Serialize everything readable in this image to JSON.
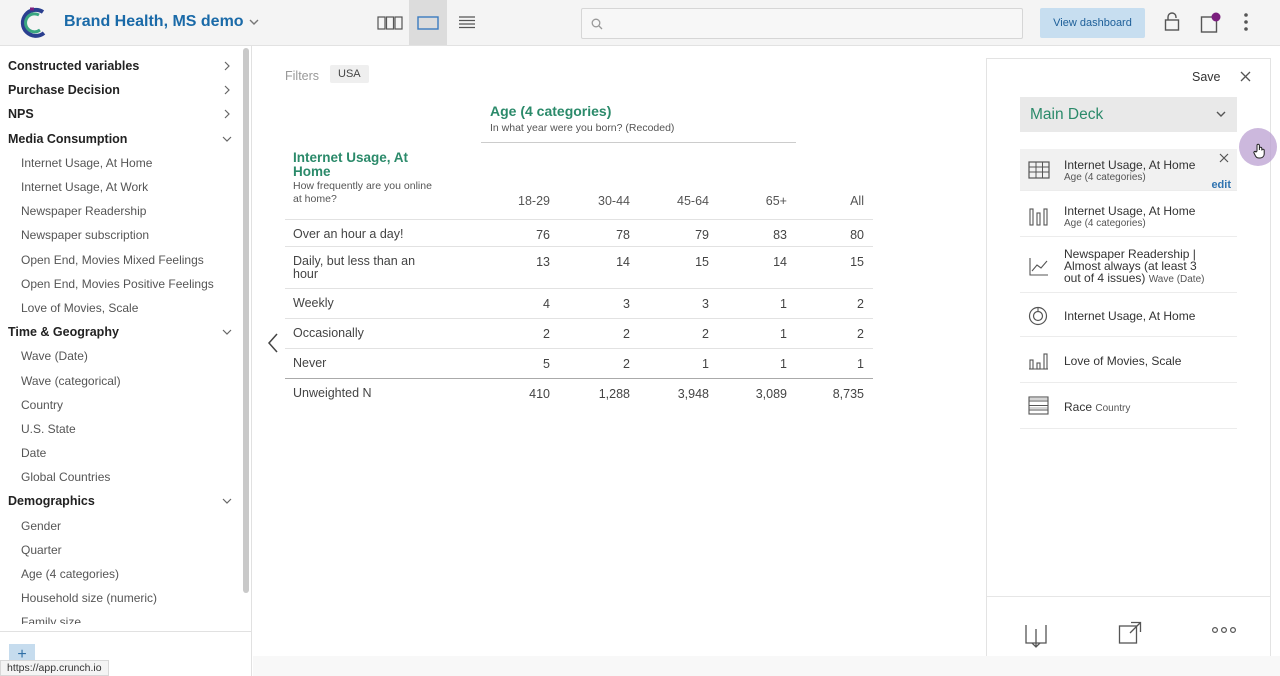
{
  "app": {
    "title": "Brand Health, MS demo",
    "view_dashboard_label": "View dashboard",
    "status_url": "https://app.crunch.io"
  },
  "colors": {
    "accent_green": "#2b8a6a",
    "brand_blue": "#1a6aa8",
    "notification": "#7b1f7e"
  },
  "sidebar": {
    "rows": [
      {
        "type": "group",
        "label": "Constructed variables",
        "icon": "chevron-right-icon"
      },
      {
        "type": "group",
        "label": "Purchase Decision",
        "icon": "chevron-right-icon"
      },
      {
        "type": "group",
        "label": "NPS",
        "icon": "chevron-right-icon"
      },
      {
        "type": "group",
        "label": "Media Consumption",
        "icon": "chevron-down-icon"
      },
      {
        "type": "item",
        "label": "Internet Usage, At Home"
      },
      {
        "type": "item",
        "label": "Internet Usage, At Work"
      },
      {
        "type": "item",
        "label": "Newspaper Readership"
      },
      {
        "type": "item",
        "label": "Newspaper subscription"
      },
      {
        "type": "item",
        "label": "Open End, Movies Mixed Feelings"
      },
      {
        "type": "item",
        "label": "Open End, Movies Positive Feelings"
      },
      {
        "type": "item",
        "label": "Love of Movies, Scale"
      },
      {
        "type": "group",
        "label": "Time & Geography",
        "icon": "chevron-down-icon"
      },
      {
        "type": "item",
        "label": "Wave (Date)"
      },
      {
        "type": "item",
        "label": "Wave (categorical)"
      },
      {
        "type": "item",
        "label": "Country"
      },
      {
        "type": "item",
        "label": "U.S. State"
      },
      {
        "type": "item",
        "label": "Date"
      },
      {
        "type": "item",
        "label": "Global Countries"
      },
      {
        "type": "group",
        "label": "Demographics",
        "icon": "chevron-down-icon"
      },
      {
        "type": "item",
        "label": "Gender"
      },
      {
        "type": "item",
        "label": "Quarter"
      },
      {
        "type": "item",
        "label": "Age (4 categories)"
      },
      {
        "type": "item",
        "label": "Household size (numeric)"
      },
      {
        "type": "item",
        "label": "Family size"
      }
    ],
    "add_label": "+"
  },
  "main": {
    "filters_label": "Filters",
    "filter_chip": "USA",
    "column_variable": {
      "title": "Age (4 categories)",
      "subtitle": "In what year were you born? (Recoded)"
    },
    "row_variable": {
      "title": "Internet Usage, At Home",
      "subtitle": "How frequently are you online at home?"
    },
    "columns": [
      "18-29",
      "30-44",
      "45-64",
      "65+",
      "All"
    ],
    "rows": [
      {
        "label": "Over an hour a day!",
        "values": [
          "76",
          "78",
          "79",
          "83",
          "80"
        ]
      },
      {
        "label": "Daily, but less than an hour",
        "values": [
          "13",
          "14",
          "15",
          "14",
          "15"
        ]
      },
      {
        "label": "Weekly",
        "values": [
          "4",
          "3",
          "3",
          "1",
          "2"
        ]
      },
      {
        "label": "Occasionally",
        "values": [
          "2",
          "2",
          "2",
          "1",
          "2"
        ]
      },
      {
        "label": "Never",
        "values": [
          "5",
          "2",
          "1",
          "1",
          "1"
        ]
      },
      {
        "label": "Unweighted N",
        "values": [
          "410",
          "1,288",
          "3,948",
          "3,089",
          "8,735"
        ]
      }
    ]
  },
  "panel": {
    "save_label": "Save",
    "deck_name": "Main Deck",
    "edit_label": "edit",
    "slides": [
      {
        "icon": "table-icon",
        "title": "Internet Usage, At Home",
        "sub": "Age (4 categories)",
        "sub_inline": ""
      },
      {
        "icon": "bar-chart-icon",
        "title": "Internet Usage, At Home",
        "sub": "Age (4 categories)",
        "sub_inline": ""
      },
      {
        "icon": "line-chart-icon",
        "title": "Newspaper Readership | Almost always (at least 3 out of 4 issues)",
        "sub": "",
        "sub_inline": "Wave (Date)"
      },
      {
        "icon": "donut-chart-icon",
        "title": "Internet Usage, At Home",
        "sub": "",
        "sub_inline": ""
      },
      {
        "icon": "column-chart-icon",
        "title": "Love of Movies, Scale",
        "sub": "",
        "sub_inline": ""
      },
      {
        "icon": "stacked-table-icon",
        "title": "Race",
        "sub": "",
        "sub_inline": "Country"
      }
    ]
  }
}
